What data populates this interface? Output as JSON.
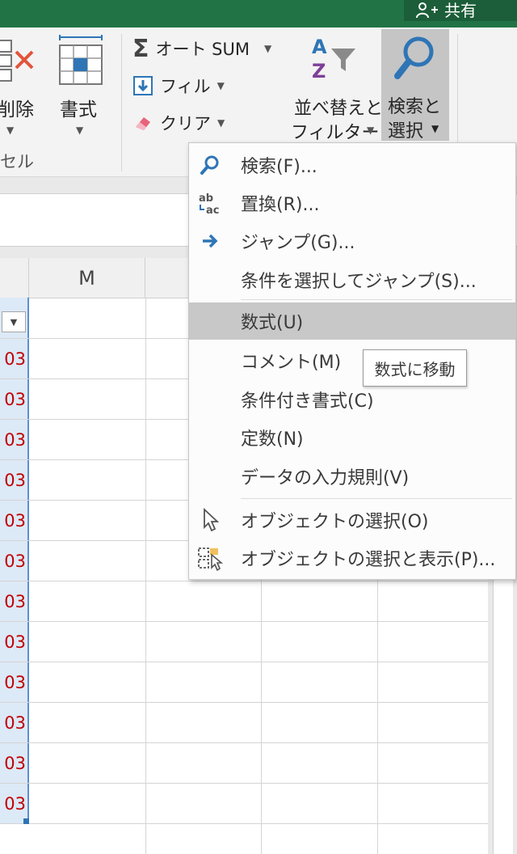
{
  "titlebar": {
    "share_label": "共有"
  },
  "ribbon": {
    "delete_label": "削除",
    "format_label": "書式",
    "cells_group_label": "セル",
    "autosum_label": "オート SUM",
    "fill_label": "フィル",
    "clear_label": "クリア",
    "sort_filter_line1": "並べ替えと",
    "sort_filter_line2": "フィルター",
    "find_select_line1": "検索と",
    "find_select_line2": "選択"
  },
  "grid": {
    "column_m": "M",
    "cell_values": [
      "03",
      "03",
      "03",
      "03",
      "03",
      "03",
      "03",
      "03",
      "03",
      "03",
      "03",
      "03"
    ]
  },
  "menu": {
    "items": [
      {
        "label": "検索(F)...",
        "icon": "magnifier-icon"
      },
      {
        "label": "置換(R)...",
        "icon": "replace-icon"
      },
      {
        "label": "ジャンプ(G)...",
        "icon": "arrow-right-icon"
      },
      {
        "label": "条件を選択してジャンプ(S)...",
        "icon": ""
      },
      {
        "label": "数式(U)",
        "icon": ""
      },
      {
        "label": "コメント(M)",
        "icon": ""
      },
      {
        "label": "条件付き書式(C)",
        "icon": ""
      },
      {
        "label": "定数(N)",
        "icon": ""
      },
      {
        "label": "データの入力規則(V)",
        "icon": ""
      },
      {
        "label": "オブジェクトの選択(O)",
        "icon": "pointer-icon"
      },
      {
        "label": "オブジェクトの選択と表示(P)...",
        "icon": "selection-pane-icon"
      }
    ],
    "tooltip": "数式に移動"
  },
  "colors": {
    "title_green": "#217346",
    "active_item": "#c8c8c8",
    "red_text": "#c00000",
    "selection_blue": "#dce9f7"
  }
}
